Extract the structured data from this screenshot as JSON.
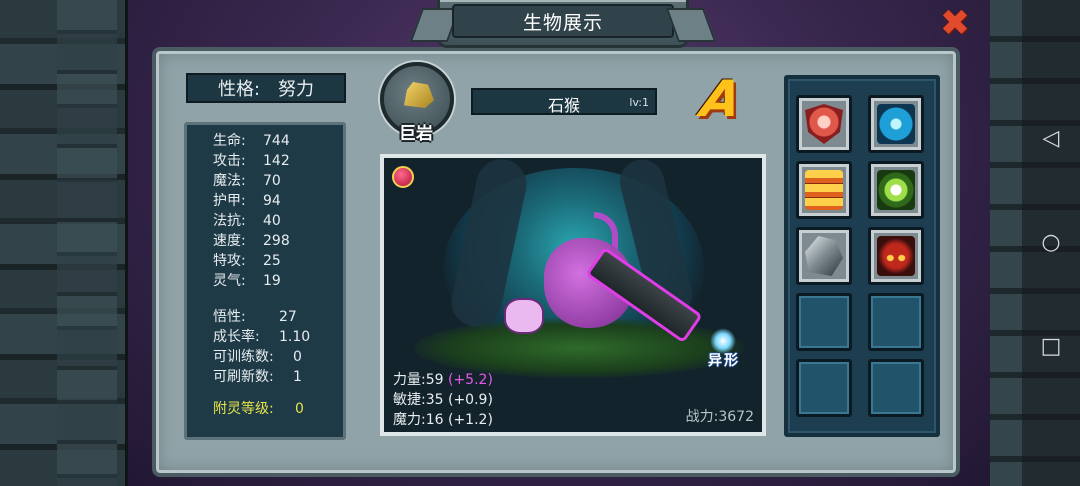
{
  "title": "生物展示",
  "nature": {
    "label": "性格:",
    "value": "努力"
  },
  "stats": [
    {
      "key": "生命:",
      "value": "744"
    },
    {
      "key": "攻击:",
      "value": "142"
    },
    {
      "key": "魔法:",
      "value": "70"
    },
    {
      "key": "护甲:",
      "value": "94"
    },
    {
      "key": "法抗:",
      "value": "40"
    },
    {
      "key": "速度:",
      "value": "298"
    },
    {
      "key": "特攻:",
      "value": "25"
    },
    {
      "key": "灵气:",
      "value": "19"
    }
  ],
  "growth": [
    {
      "key": "悟性:",
      "value": "27"
    },
    {
      "key": "成长率:",
      "value": "1.10"
    },
    {
      "key": "可训练数:",
      "value": "0"
    },
    {
      "key": "可刷新数:",
      "value": "1"
    }
  ],
  "enchant": {
    "key": "附灵等级:",
    "value": "0"
  },
  "creature": {
    "type_label": "巨岩",
    "type_icon": "rock-icon",
    "name": "石猴",
    "level": "lv:1",
    "grade": "A",
    "variant_label": "异形"
  },
  "attributes": [
    {
      "label": "力量:59",
      "bonus": "(+5.2)",
      "highlight": true
    },
    {
      "label": "敏捷:35",
      "bonus": "(+0.9)",
      "highlight": false
    },
    {
      "label": "魔力:16",
      "bonus": "(+1.2)",
      "highlight": false
    }
  ],
  "power": "战力:3672",
  "skills": [
    {
      "icon": "shield-skill-icon",
      "filled": true
    },
    {
      "icon": "arm-skill-icon",
      "filled": true
    },
    {
      "icon": "scales-skill-icon",
      "filled": true
    },
    {
      "icon": "eye-skill-icon",
      "filled": true
    },
    {
      "icon": "helm-skill-icon",
      "filled": true
    },
    {
      "icon": "mask-skill-icon",
      "filled": true
    },
    {
      "icon": "",
      "filled": false
    },
    {
      "icon": "",
      "filled": false
    },
    {
      "icon": "",
      "filled": false
    },
    {
      "icon": "",
      "filled": false
    }
  ],
  "colors": {
    "panel": "#8fa3a8",
    "dark_box": "#1f3a47",
    "enchant_text": "#e5e34a",
    "bonus_highlight": "#e45ae8",
    "grade": "#ffc21a",
    "close": "#e24a2e"
  }
}
